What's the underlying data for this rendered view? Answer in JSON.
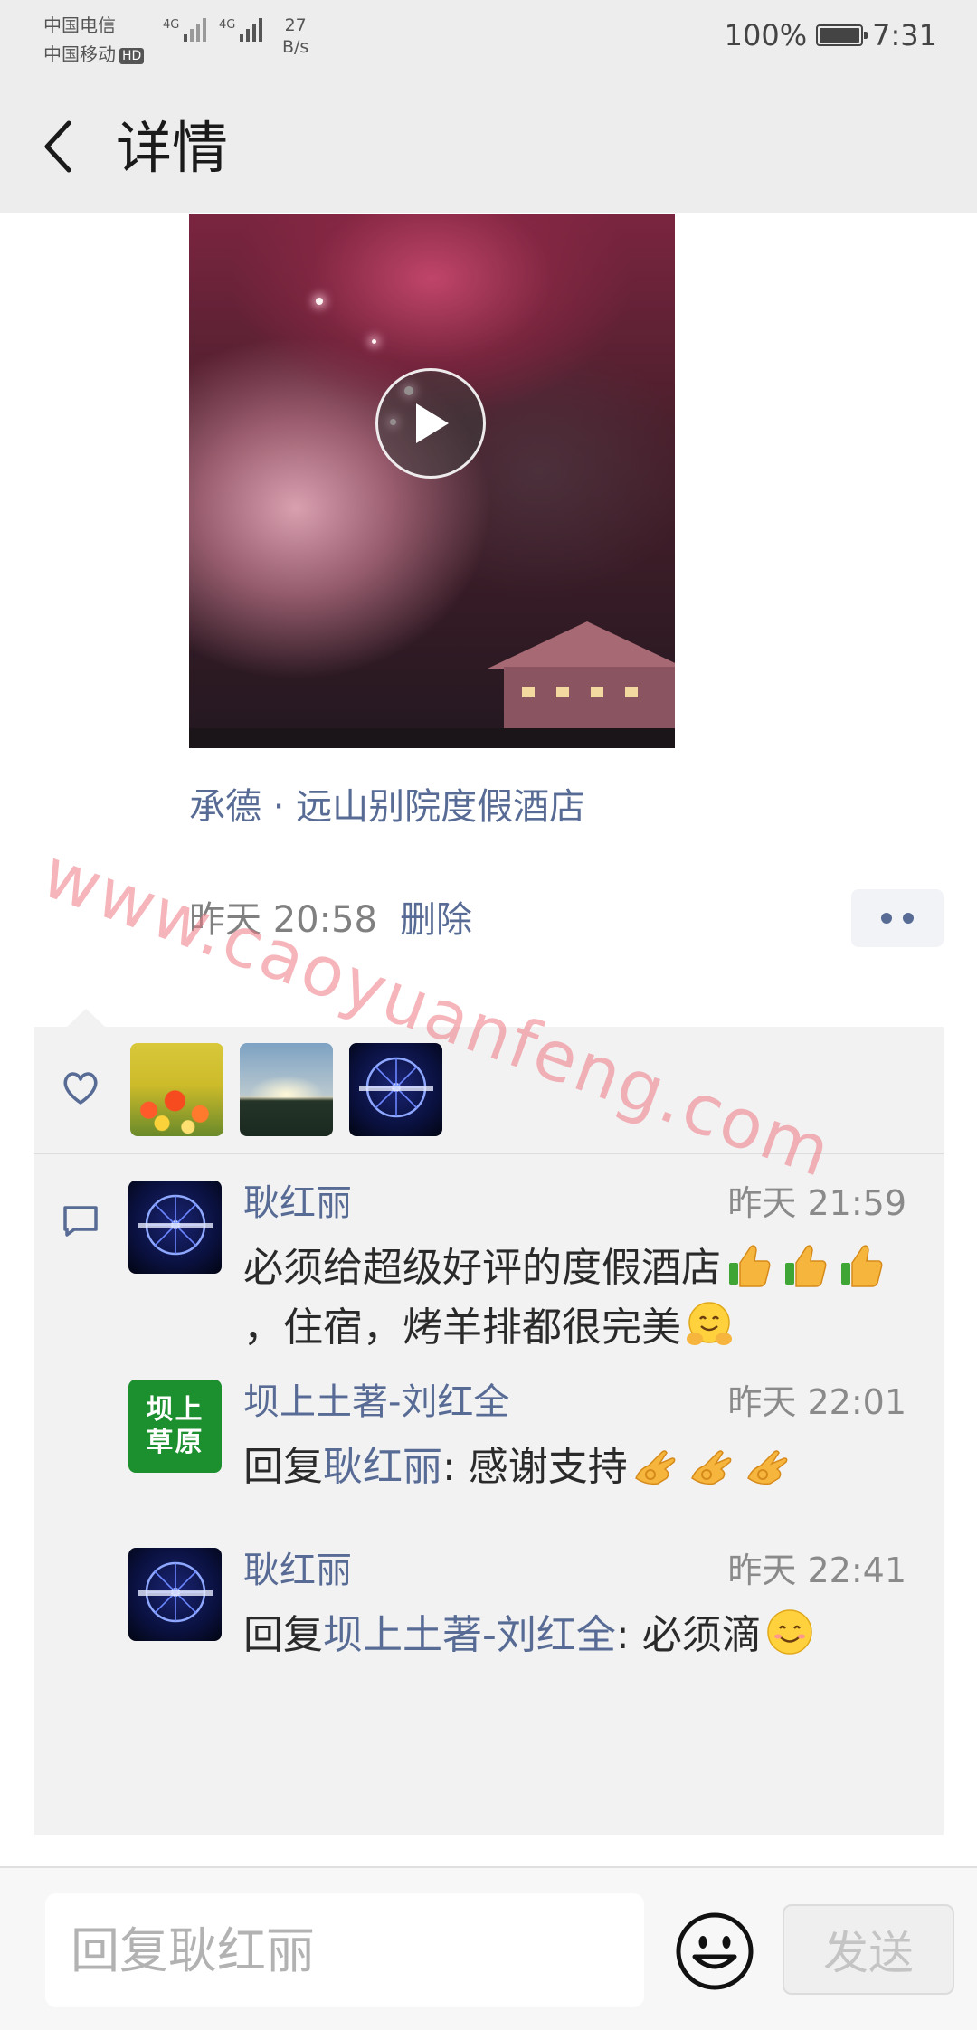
{
  "status_bar": {
    "carrier_1": "中国电信",
    "carrier_2": "中国移动",
    "hd_badge": "HD",
    "net_tag_1": "4G",
    "net_tag_2": "4G",
    "net_speed_value": "27",
    "net_speed_unit": "B/s",
    "battery_percent": "100%",
    "time": "7:31"
  },
  "nav": {
    "title": "详情",
    "back_icon": "chevron-left-icon"
  },
  "post": {
    "video_icon": "play-icon",
    "location": "承德 · 远山别院度假酒店",
    "time": "昨天 20:58",
    "delete_label": "删除",
    "more_icon": "more-dots-icon"
  },
  "likes": {
    "icon": "heart-icon",
    "avatars": [
      "flowers-avatar",
      "landscape-avatar",
      "ferris-wheel-avatar"
    ]
  },
  "comments_icon": "comment-icon",
  "comments": [
    {
      "author": "耿红丽",
      "time": "昨天 21:59",
      "text_1": "必须给超级好评的度假酒店",
      "text_2": "，住宿，烤羊排都很完美",
      "emojis": [
        "thumbs-up",
        "thumbs-up",
        "thumbs-up",
        "hugging-face"
      ]
    },
    {
      "author": "坝上土著-刘红全",
      "avatar_text_1": "坝上",
      "avatar_text_2": "草原",
      "time": "昨天 22:01",
      "reply_prefix": "回复",
      "reply_to": "耿红丽",
      "text": ": 感谢支持",
      "emojis": [
        "ok-hand",
        "ok-hand",
        "ok-hand"
      ]
    },
    {
      "author": "耿红丽",
      "time": "昨天 22:41",
      "reply_prefix": "回复",
      "reply_to": "坝上土著-刘红全",
      "text": ": 必须滴",
      "emojis": [
        "smiling-face"
      ]
    }
  ],
  "reply_bar": {
    "placeholder": "回复耿红丽",
    "emoji_icon": "emoji-icon",
    "send_label": "发送"
  },
  "watermark": "www.caoyuanfeng.com",
  "colors": {
    "link_blue": "#576b95",
    "panel_bg": "#f2f2f3",
    "bar_bg": "#ededed"
  }
}
